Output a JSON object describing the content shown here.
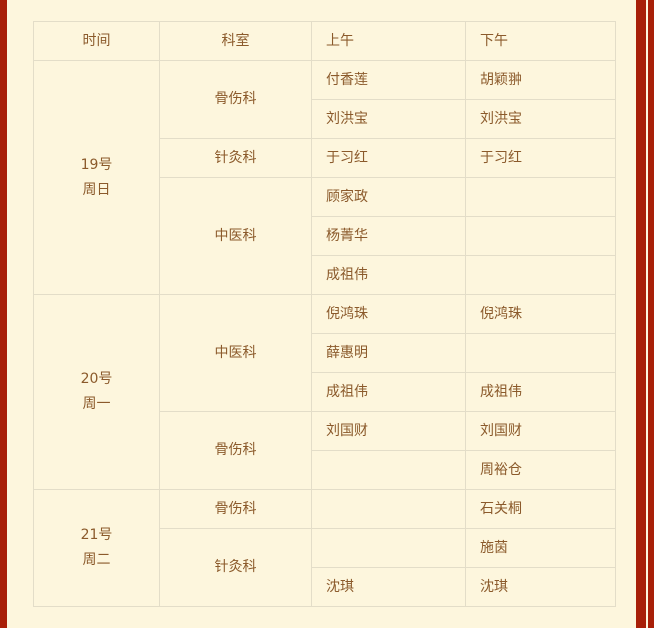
{
  "theme": {
    "page_background": "#fdf6dd",
    "frame_color": "#a81f08",
    "text_color": "#8b5a2b",
    "grid_color": "#e3ddc8"
  },
  "table": {
    "headers": {
      "time": "时间",
      "department": "科室",
      "morning": "上午",
      "afternoon": "下午"
    },
    "days": [
      {
        "date": "19号",
        "weekday": "周日",
        "rowspan": 6,
        "departments": [
          {
            "name": "骨伤科",
            "rowspan": 2,
            "rows": [
              {
                "morning": "付香莲",
                "afternoon": "胡颖翀"
              },
              {
                "morning": "刘洪宝",
                "afternoon": "刘洪宝"
              }
            ]
          },
          {
            "name": "针灸科",
            "rowspan": 1,
            "rows": [
              {
                "morning": "于习红",
                "afternoon": "于习红"
              }
            ]
          },
          {
            "name": "中医科",
            "rowspan": 3,
            "rows": [
              {
                "morning": "顾家政",
                "afternoon": ""
              },
              {
                "morning": "杨菁华",
                "afternoon": ""
              },
              {
                "morning": "成祖伟",
                "afternoon": ""
              }
            ]
          }
        ]
      },
      {
        "date": "20号",
        "weekday": "周一",
        "rowspan": 5,
        "departments": [
          {
            "name": "中医科",
            "rowspan": 3,
            "rows": [
              {
                "morning": "倪鸿珠",
                "afternoon": "倪鸿珠"
              },
              {
                "morning": "薛惠明",
                "afternoon": ""
              },
              {
                "morning": "成祖伟",
                "afternoon": "成祖伟"
              }
            ]
          },
          {
            "name": "骨伤科",
            "rowspan": 2,
            "rows": [
              {
                "morning": "刘国财",
                "afternoon": "刘国财"
              },
              {
                "morning": "",
                "afternoon": "周裕仓"
              }
            ]
          }
        ]
      },
      {
        "date": "21号",
        "weekday": "周二",
        "rowspan": 3,
        "departments": [
          {
            "name": "骨伤科",
            "rowspan": 1,
            "rows": [
              {
                "morning": "",
                "afternoon": "石关桐"
              }
            ]
          },
          {
            "name": "针灸科",
            "rowspan": 2,
            "rows": [
              {
                "morning": "",
                "afternoon": "施茵"
              },
              {
                "morning": "沈琪",
                "afternoon": "沈琪"
              }
            ]
          }
        ]
      }
    ]
  }
}
